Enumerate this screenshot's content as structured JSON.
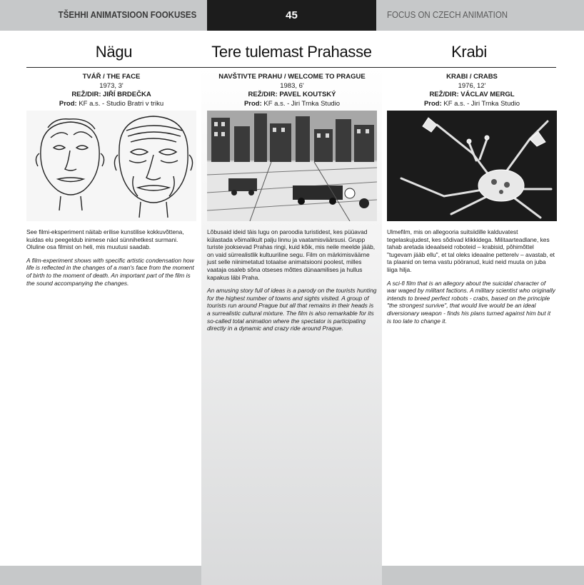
{
  "header": {
    "left": "TŠEHHI ANIMATSIOON FOOKUSES",
    "page_number": "45",
    "right": "FOCUS ON CZECH ANIMATION"
  },
  "films": [
    {
      "title": "Nägu",
      "original_title": "TVÁŘ / THE FACE",
      "year_length": "1973, 3'",
      "director_label": "REŽ/DIR:",
      "director": "JIŘÍ BRDEČKA",
      "prod_label": "Prod:",
      "prod": "KF a.s. - Studio Bratri v triku",
      "text_et": "See filmi-eksperiment näitab erilise kunstilise kokkuvõttena, kuidas elu peegeldub inimese näol sünnihetkest surmani. Oluline osa filmist on heli, mis muutusi saadab.",
      "text_en": "A film-experiment shows with specific artistic condensation how life is reflected in the changes of a man's face from the moment of birth to the moment of death. An important part of the film is the sound accompanying the changes."
    },
    {
      "title": "Tere tulemast Prahasse",
      "original_title": "NAVŠTIVTE PRAHU / WELCOME TO PRAGUE",
      "year_length": "1983, 6'",
      "director_label": "REŽ/DIR:",
      "director": "PAVEL KOUTSKÝ",
      "prod_label": "Prod:",
      "prod": "KF a.s. - Jiri Trnka Studio",
      "text_et": "Lõbusaid ideid täis lugu on paroodia turistidest, kes püüavad külastada võimalikult palju linnu ja vaatamisväärsusi. Grupp turiste jooksevad Prahas ringi, kuid kõik, mis neile meelde jääb, on vaid sürrealistlik kultuuriline segu. Film on märkimisväärne just selle niinimetatud totaalse animatsiooni poolest, milles vaataja osaleb sõna otseses mõttes dünaamilises ja hullus kapakus läbi Praha.",
      "text_en": "An amusing story full of ideas is a parody on the tourists hunting for the highest number of towns and sights visited. A group of tourists run around Prague but all that remains in their heads is a surrealistic cultural mixture. The film is also remarkable for its so-called total animation where the spectator is participating directly in a dynamic and crazy ride around Prague."
    },
    {
      "title": "Krabi",
      "original_title": "KRABI / CRABS",
      "year_length": "1976, 12'",
      "director_label": "REŽ/DIR:",
      "director": "VÁCLAV MERGL",
      "prod_label": "Prod:",
      "prod": "KF a.s. - Jiri Trnka Studio",
      "text_et": "Ulmefilm, mis on allegooria suitsiidille kalduvatest tegelaskujudest, kes sõdivad klikkidega. Militaarteadlane, kes tahab aretada ideaalseid roboteid – krabisid, põhimõttel \"tugevam jääb ellu\", et tal oleks ideaalne petterelv – avastab, et ta plaanid on tema vastu pööranud, kuid neid muuta on juba liiga hilja.",
      "text_en": "A sci-fi film that is an allegory about the suicidal character of war waged by militant factions. A military scientist who originally intends to breed perfect robots - crabs, based on the principle \"the strongest survive\", that would live would be an ideal diversionary weapon - finds his plans turned against him but it is too late to change it."
    }
  ]
}
